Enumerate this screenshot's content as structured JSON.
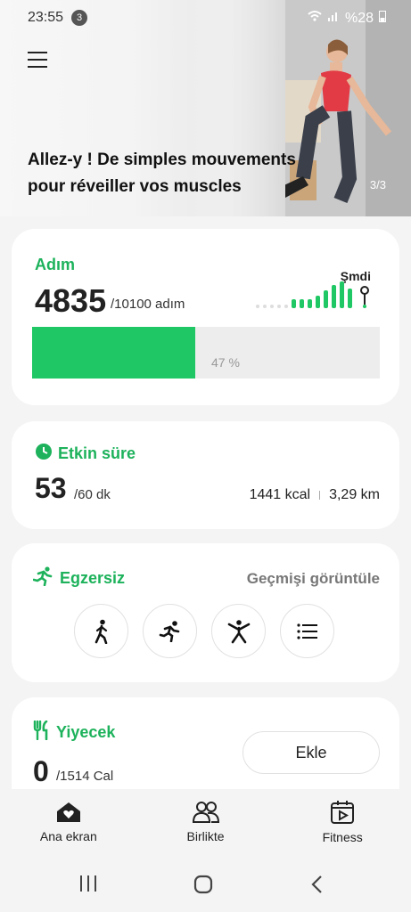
{
  "status": {
    "time": "23:55",
    "notifications": "3",
    "battery": "%28"
  },
  "hero": {
    "title": "Allez-y ! De simples mouvements pour réveiller vos muscles",
    "counter": "3/3"
  },
  "steps": {
    "title": "Adım",
    "value": "4835",
    "goal": "/10100 adım",
    "now_label": "Şmdi",
    "progress": 0.47,
    "percent_label": "47 %"
  },
  "active": {
    "title": "Etkin süre",
    "value": "53",
    "goal": "/60 dk",
    "kcal": "1441 kcal",
    "distance": "3,29 km"
  },
  "exercise": {
    "title": "Egzersiz",
    "history": "Geçmişi görüntüle",
    "buttons": [
      "walk-icon",
      "run-icon",
      "workout-icon",
      "list-icon"
    ]
  },
  "food": {
    "title": "Yiyecek",
    "value": "0",
    "goal": "/1514 Cal",
    "add_label": "Ekle"
  },
  "nav": {
    "home": "Ana ekran",
    "together": "Birlikte",
    "fitness": "Fitness"
  },
  "colors": {
    "accent": "#1db25b",
    "bar": "#1fc864"
  }
}
